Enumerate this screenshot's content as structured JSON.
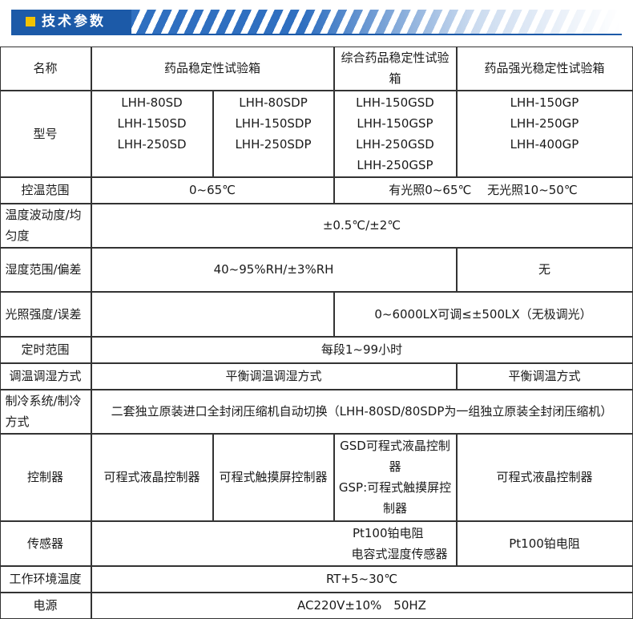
{
  "section_title": "技术参数",
  "header": {
    "name_label": "名称",
    "col_a": "药品稳定性试验箱",
    "col_b": "综合药品稳定性试验箱",
    "col_c": "药品强光稳定性试验箱"
  },
  "models": {
    "label": "型号",
    "a1": [
      "LHH-80SD",
      "LHH-150SD",
      "LHH-250SD"
    ],
    "a2": [
      "LHH-80SDP",
      "LHH-150SDP",
      "LHH-250SDP"
    ],
    "b": [
      "LHH-150GSD",
      "LHH-150GSP",
      "LHH-250GSD",
      "LHH-250GSP"
    ],
    "c": [
      "LHH-150GP",
      "LHH-250GP",
      "LHH-400GP"
    ]
  },
  "temp_range": {
    "label": "控温范围",
    "a": "0~65℃",
    "bc": "有光照0~65℃　 无光照10~50℃"
  },
  "temp_fluct": {
    "label": "温度波动度/均匀度",
    "value": "±0.5℃/±2℃"
  },
  "humidity": {
    "label": "湿度范围/偏差",
    "ab": "40~95%RH/±3%RH",
    "c": "无"
  },
  "light": {
    "label": "光照强度/误差",
    "a": "",
    "bc": "0~6000LX可调≤±500LX（无极调光）"
  },
  "timer": {
    "label": "定时范围",
    "value": "每段1~99小时"
  },
  "adjust": {
    "label": "调温调湿方式",
    "ab": "平衡调温调湿方式",
    "c": "平衡调温方式"
  },
  "cooling": {
    "label": "制冷系统/制冷方式",
    "value": "二套独立原装进口全封闭压缩机自动切换（LHH-80SD/80SDP为一组独立原装全封闭压缩机）"
  },
  "controller": {
    "label": "控制器",
    "a1": "可程式液晶控制器",
    "a2": "可程式触摸屏控制器",
    "b1": "GSD可程式液晶控制器",
    "b2": "GSP:可程式触摸屏控制器",
    "c": "可程式液晶控制器"
  },
  "sensor": {
    "label": "传感器",
    "ab1": "Pt100铂电阻",
    "ab2": "电容式湿度传感器",
    "c": "Pt100铂电阻"
  },
  "ambient": {
    "label": "工作环境温度",
    "value": "RT+5~30℃"
  },
  "power": {
    "label": "电源",
    "value": "AC220V±10%　50HZ"
  },
  "colors": {
    "banner": "#1c5aa8",
    "accent_square": "#f2c200",
    "border": "#333333"
  }
}
